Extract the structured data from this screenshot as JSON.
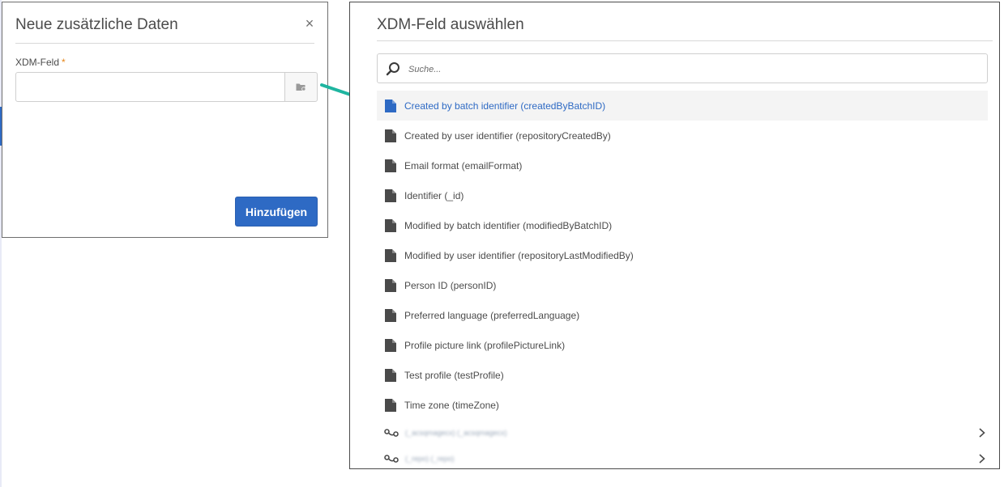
{
  "dialog": {
    "title": "Neue zusätzliche Daten",
    "close_symbol": "×",
    "field_label": "XDM-Feld",
    "required_mark": "*",
    "field_value": "",
    "picker_icon": "folder-picker-icon",
    "add_label": "Hinzufügen"
  },
  "panel": {
    "title": "XDM-Feld auswählen",
    "search_placeholder": "Suche..."
  },
  "fields": [
    {
      "label": "Created by batch identifier (createdByBatchID)",
      "selected": true
    },
    {
      "label": "Created by user identifier (repositoryCreatedBy)"
    },
    {
      "label": "Email format (emailFormat)"
    },
    {
      "label": "Identifier (_id)"
    },
    {
      "label": "Modified by batch identifier (modifiedByBatchID)"
    },
    {
      "label": "Modified by user identifier (repositoryLastModifiedBy)"
    },
    {
      "label": "Person ID (personID)"
    },
    {
      "label": "Preferred language (preferredLanguage)"
    },
    {
      "label": "Profile picture link (profilePictureLink)"
    },
    {
      "label": "Test profile (testProfile)"
    },
    {
      "label": "Time zone (timeZone)"
    }
  ],
  "objects": [
    {
      "label": "(_acsqmagecx) (_acsqmagecx)"
    },
    {
      "label": "(_repo) (_repo)"
    }
  ],
  "colors": {
    "accent": "#2e6ac4",
    "arrow": "#1fb5a0",
    "required": "#e68619"
  }
}
